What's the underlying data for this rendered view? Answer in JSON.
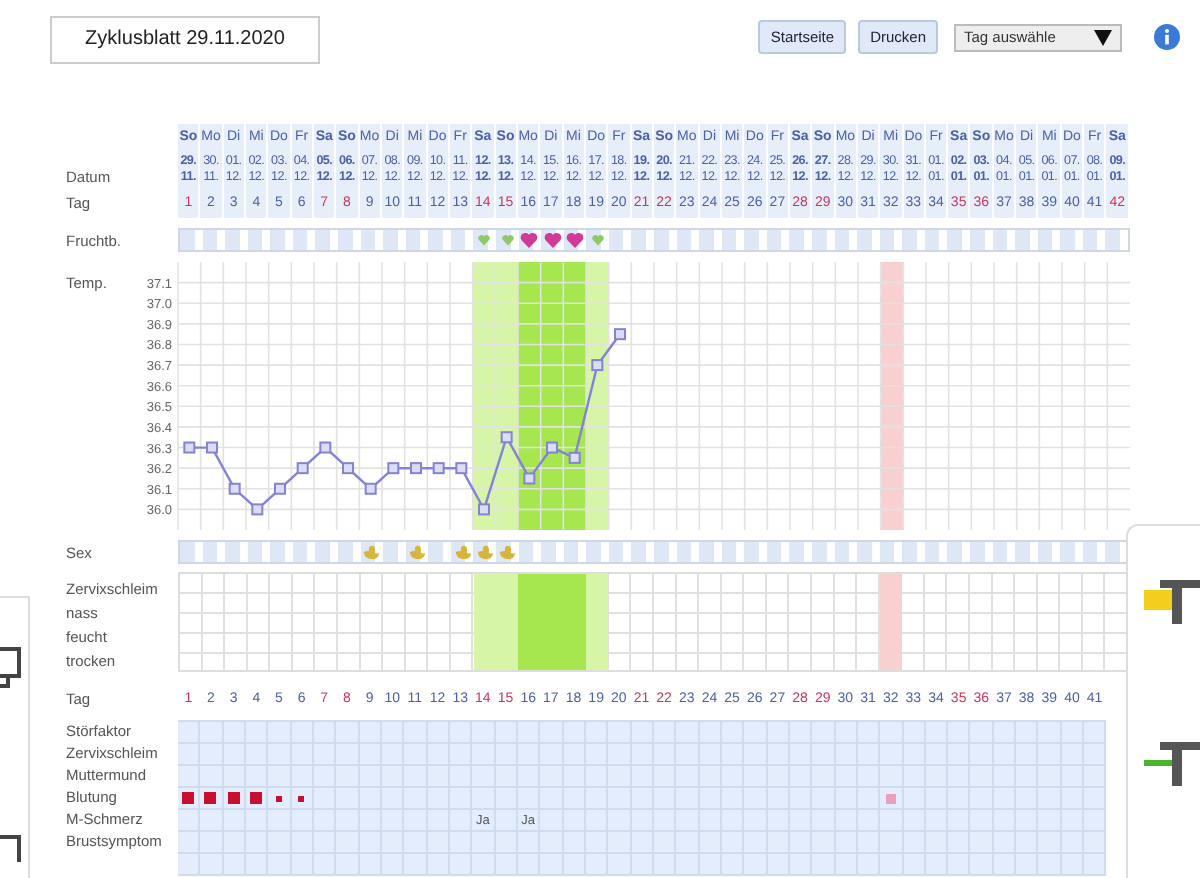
{
  "title": "Zyklusblatt 29.11.2020",
  "buttons": [
    {
      "label": "Startseite"
    },
    {
      "label": "Drucken"
    }
  ],
  "day_select": {
    "value": "Tag auswähle"
  },
  "labels": {
    "date": "Datum",
    "day": "Tag",
    "fertility": "Fruchtb.",
    "temp": "Temp.",
    "sex": "Sex",
    "mucus": "Zervixschleim",
    "mucus_levels": [
      "nass",
      "feucht",
      "trocken"
    ],
    "day_lower": "Tag"
  },
  "days": [
    {
      "weekday": "So",
      "date": "29.",
      "month": "11.",
      "day": "1",
      "weekend": true,
      "fertile": false,
      "peak": false,
      "sex": false,
      "marked": false
    },
    {
      "weekday": "Mo",
      "date": "30.",
      "month": "11.",
      "day": "2",
      "weekend": false,
      "fertile": false,
      "peak": false,
      "sex": false,
      "marked": false
    },
    {
      "weekday": "Di",
      "date": "01.",
      "month": "12.",
      "day": "3",
      "weekend": false,
      "fertile": false,
      "peak": false,
      "sex": false,
      "marked": false
    },
    {
      "weekday": "Mi",
      "date": "02.",
      "month": "12.",
      "day": "4",
      "weekend": false,
      "fertile": false,
      "peak": false,
      "sex": false,
      "marked": false
    },
    {
      "weekday": "Do",
      "date": "03.",
      "month": "12.",
      "day": "5",
      "weekend": false,
      "fertile": false,
      "peak": false,
      "sex": false,
      "marked": false
    },
    {
      "weekday": "Fr",
      "date": "04.",
      "month": "12.",
      "day": "6",
      "weekend": false,
      "fertile": false,
      "peak": false,
      "sex": false,
      "marked": false
    },
    {
      "weekday": "Sa",
      "date": "05.",
      "month": "12.",
      "day": "7",
      "weekend": true,
      "fertile": false,
      "peak": false,
      "sex": false,
      "marked": false
    },
    {
      "weekday": "So",
      "date": "06.",
      "month": "12.",
      "day": "8",
      "weekend": true,
      "fertile": false,
      "peak": false,
      "sex": false,
      "marked": false
    },
    {
      "weekday": "Mo",
      "date": "07.",
      "month": "12.",
      "day": "9",
      "weekend": false,
      "fertile": false,
      "peak": false,
      "sex": true,
      "marked": false
    },
    {
      "weekday": "Di",
      "date": "08.",
      "month": "12.",
      "day": "10",
      "weekend": false,
      "fertile": false,
      "peak": false,
      "sex": false,
      "marked": false
    },
    {
      "weekday": "Mi",
      "date": "09.",
      "month": "12.",
      "day": "11",
      "weekend": false,
      "fertile": false,
      "peak": false,
      "sex": true,
      "marked": false
    },
    {
      "weekday": "Do",
      "date": "10.",
      "month": "12.",
      "day": "12",
      "weekend": false,
      "fertile": false,
      "peak": false,
      "sex": false,
      "marked": false
    },
    {
      "weekday": "Fr",
      "date": "11.",
      "month": "12.",
      "day": "13",
      "weekend": false,
      "fertile": false,
      "peak": false,
      "sex": true,
      "marked": false
    },
    {
      "weekday": "Sa",
      "date": "12.",
      "month": "12.",
      "day": "14",
      "weekend": true,
      "fertile": true,
      "peak": false,
      "sex": true,
      "marked": false
    },
    {
      "weekday": "So",
      "date": "13.",
      "month": "12.",
      "day": "15",
      "weekend": true,
      "fertile": true,
      "peak": false,
      "sex": true,
      "marked": false
    },
    {
      "weekday": "Mo",
      "date": "14.",
      "month": "12.",
      "day": "16",
      "weekend": false,
      "fertile": true,
      "peak": true,
      "sex": false,
      "marked": false
    },
    {
      "weekday": "Di",
      "date": "15.",
      "month": "12.",
      "day": "17",
      "weekend": false,
      "fertile": true,
      "peak": true,
      "sex": false,
      "marked": false
    },
    {
      "weekday": "Mi",
      "date": "16.",
      "month": "12.",
      "day": "18",
      "weekend": false,
      "fertile": true,
      "peak": true,
      "sex": false,
      "marked": false
    },
    {
      "weekday": "Do",
      "date": "17.",
      "month": "12.",
      "day": "19",
      "weekend": false,
      "fertile": true,
      "peak": false,
      "sex": false,
      "marked": false
    },
    {
      "weekday": "Fr",
      "date": "18.",
      "month": "12.",
      "day": "20",
      "weekend": false,
      "fertile": false,
      "peak": false,
      "sex": false,
      "marked": false
    },
    {
      "weekday": "Sa",
      "date": "19.",
      "month": "12.",
      "day": "21",
      "weekend": true,
      "fertile": false,
      "peak": false,
      "sex": false,
      "marked": false
    },
    {
      "weekday": "So",
      "date": "20.",
      "month": "12.",
      "day": "22",
      "weekend": true,
      "fertile": false,
      "peak": false,
      "sex": false,
      "marked": false
    },
    {
      "weekday": "Mo",
      "date": "21.",
      "month": "12.",
      "day": "23",
      "weekend": false,
      "fertile": false,
      "peak": false,
      "sex": false,
      "marked": false
    },
    {
      "weekday": "Di",
      "date": "22.",
      "month": "12.",
      "day": "24",
      "weekend": false,
      "fertile": false,
      "peak": false,
      "sex": false,
      "marked": false
    },
    {
      "weekday": "Mi",
      "date": "23.",
      "month": "12.",
      "day": "25",
      "weekend": false,
      "fertile": false,
      "peak": false,
      "sex": false,
      "marked": false
    },
    {
      "weekday": "Do",
      "date": "24.",
      "month": "12.",
      "day": "26",
      "weekend": false,
      "fertile": false,
      "peak": false,
      "sex": false,
      "marked": false
    },
    {
      "weekday": "Fr",
      "date": "25.",
      "month": "12.",
      "day": "27",
      "weekend": false,
      "fertile": false,
      "peak": false,
      "sex": false,
      "marked": false
    },
    {
      "weekday": "Sa",
      "date": "26.",
      "month": "12.",
      "day": "28",
      "weekend": true,
      "fertile": false,
      "peak": false,
      "sex": false,
      "marked": false
    },
    {
      "weekday": "So",
      "date": "27.",
      "month": "12.",
      "day": "29",
      "weekend": true,
      "fertile": false,
      "peak": false,
      "sex": false,
      "marked": false
    },
    {
      "weekday": "Mo",
      "date": "28.",
      "month": "12.",
      "day": "30",
      "weekend": false,
      "fertile": false,
      "peak": false,
      "sex": false,
      "marked": false
    },
    {
      "weekday": "Di",
      "date": "29.",
      "month": "12.",
      "day": "31",
      "weekend": false,
      "fertile": false,
      "peak": false,
      "sex": false,
      "marked": false
    },
    {
      "weekday": "Mi",
      "date": "30.",
      "month": "12.",
      "day": "32",
      "weekend": false,
      "fertile": false,
      "peak": false,
      "sex": false,
      "marked": true
    },
    {
      "weekday": "Do",
      "date": "31.",
      "month": "12.",
      "day": "33",
      "weekend": false,
      "fertile": false,
      "peak": false,
      "sex": false,
      "marked": false
    },
    {
      "weekday": "Fr",
      "date": "01.",
      "month": "01.",
      "day": "34",
      "weekend": false,
      "fertile": false,
      "peak": false,
      "sex": false,
      "marked": false
    },
    {
      "weekday": "Sa",
      "date": "02.",
      "month": "01.",
      "day": "35",
      "weekend": true,
      "fertile": false,
      "peak": false,
      "sex": false,
      "marked": false
    },
    {
      "weekday": "So",
      "date": "03.",
      "month": "01.",
      "day": "36",
      "weekend": true,
      "fertile": false,
      "peak": false,
      "sex": false,
      "marked": false
    },
    {
      "weekday": "Mo",
      "date": "04.",
      "month": "01.",
      "day": "37",
      "weekend": false,
      "fertile": false,
      "peak": false,
      "sex": false,
      "marked": false
    },
    {
      "weekday": "Di",
      "date": "05.",
      "month": "01.",
      "day": "38",
      "weekend": false,
      "fertile": false,
      "peak": false,
      "sex": false,
      "marked": false
    },
    {
      "weekday": "Mi",
      "date": "06.",
      "month": "01.",
      "day": "39",
      "weekend": false,
      "fertile": false,
      "peak": false,
      "sex": false,
      "marked": false
    },
    {
      "weekday": "Do",
      "date": "07.",
      "month": "01.",
      "day": "40",
      "weekend": false,
      "fertile": false,
      "peak": false,
      "sex": false,
      "marked": false
    },
    {
      "weekday": "Fr",
      "date": "08.",
      "month": "01.",
      "day": "41",
      "weekend": false,
      "fertile": false,
      "peak": false,
      "sex": false,
      "marked": false
    },
    {
      "weekday": "Sa",
      "date": "09.",
      "month": "01.",
      "day": "42",
      "weekend": true,
      "fertile": false,
      "peak": false,
      "sex": false,
      "marked": false
    }
  ],
  "temperature": {
    "chart_data": {
      "type": "line",
      "categories": [
        null,
        null,
        null,
        null,
        null,
        null,
        null,
        null,
        null,
        null,
        null,
        null,
        null,
        null,
        null,
        null,
        null,
        null,
        null,
        null,
        null,
        null,
        null,
        null,
        null,
        null,
        null,
        null,
        null,
        null,
        null,
        null,
        null,
        null,
        null,
        null,
        null,
        null,
        null,
        null,
        null,
        null
      ],
      "ylim": [
        35.9,
        37.2
      ],
      "grid": true,
      "series": [
        {
          "color": "#8383d6",
          "marker": "square",
          "values": [
            36.3,
            36.3,
            36.1,
            36.0,
            36.1,
            36.2,
            36.3,
            36.2,
            36.1,
            36.2,
            36.2,
            36.2,
            36.2,
            36.0,
            36.35,
            36.15,
            36.3,
            36.25,
            36.7,
            36.85,
            null,
            null,
            null,
            null,
            null,
            null,
            null,
            null,
            null,
            null,
            null,
            null,
            null,
            null,
            null,
            null,
            null,
            null,
            null,
            null,
            null,
            null
          ]
        }
      ],
      "yticks": [
        {
          "value": 36.0,
          "label": "36.0"
        },
        {
          "value": 36.1,
          "label": "36.1"
        },
        {
          "value": 36.2,
          "label": "36.2"
        },
        {
          "value": 36.3,
          "label": "36.3"
        },
        {
          "value": 36.4,
          "label": "36.4"
        },
        {
          "value": 36.5,
          "label": "36.5"
        },
        {
          "value": 36.6,
          "label": "36.6"
        },
        {
          "value": 36.7,
          "label": "36.7"
        },
        {
          "value": 36.8,
          "label": "36.8"
        },
        {
          "value": 36.9,
          "label": "36.9"
        },
        {
          "value": 37.0,
          "label": "37.0"
        },
        {
          "value": 37.1,
          "label": "37.1"
        }
      ]
    }
  },
  "lower": {
    "rows": [
      {
        "label": "Störfaktor",
        "kind": "plain"
      },
      {
        "label": "Zervixschleim",
        "kind": "plain"
      },
      {
        "label": "Muttermund",
        "kind": "plain"
      },
      {
        "label": "Blutung",
        "kind": "bleeding"
      },
      {
        "label": "M-Schmerz",
        "kind": "pain"
      },
      {
        "label": "Brustsymptom",
        "kind": "plain"
      }
    ],
    "days": [
      {
        "day": "1",
        "weekend": true,
        "bleeding": {
          "heavy": true,
          "color": "#c8102e"
        }
      },
      {
        "day": "2",
        "weekend": false,
        "bleeding": {
          "heavy": true,
          "color": "#c8102e"
        }
      },
      {
        "day": "3",
        "weekend": false,
        "bleeding": {
          "heavy": true,
          "color": "#c8102e"
        }
      },
      {
        "day": "4",
        "weekend": false,
        "bleeding": {
          "heavy": true,
          "color": "#c8102e"
        }
      },
      {
        "day": "5",
        "weekend": false,
        "bleeding": {
          "heavy": false,
          "color": "#c8102e"
        }
      },
      {
        "day": "6",
        "weekend": false,
        "bleeding": {
          "heavy": false,
          "color": "#c8102e"
        }
      },
      {
        "day": "7",
        "weekend": true
      },
      {
        "day": "8",
        "weekend": true
      },
      {
        "day": "9",
        "weekend": false
      },
      {
        "day": "10",
        "weekend": false
      },
      {
        "day": "11",
        "weekend": false
      },
      {
        "day": "12",
        "weekend": false
      },
      {
        "day": "13",
        "weekend": false
      },
      {
        "day": "14",
        "weekend": true,
        "pain": "Ja"
      },
      {
        "day": "15",
        "weekend": true
      },
      {
        "day": "16",
        "weekend": false,
        "pain": "Ja"
      },
      {
        "day": "17",
        "weekend": false
      },
      {
        "day": "18",
        "weekend": false
      },
      {
        "day": "19",
        "weekend": false
      },
      {
        "day": "20",
        "weekend": false
      },
      {
        "day": "21",
        "weekend": true
      },
      {
        "day": "22",
        "weekend": true
      },
      {
        "day": "23",
        "weekend": false
      },
      {
        "day": "24",
        "weekend": false
      },
      {
        "day": "25",
        "weekend": false
      },
      {
        "day": "26",
        "weekend": false
      },
      {
        "day": "27",
        "weekend": false
      },
      {
        "day": "28",
        "weekend": true
      },
      {
        "day": "29",
        "weekend": true
      },
      {
        "day": "30",
        "weekend": false
      },
      {
        "day": "31",
        "weekend": false
      },
      {
        "day": "32",
        "weekend": false,
        "bleeding": {
          "heavy": false,
          "color": "#e8a0bc"
        }
      },
      {
        "day": "33",
        "weekend": false
      },
      {
        "day": "34",
        "weekend": false
      },
      {
        "day": "35",
        "weekend": true
      },
      {
        "day": "36",
        "weekend": true
      },
      {
        "day": "37",
        "weekend": false
      },
      {
        "day": "38",
        "weekend": false
      },
      {
        "day": "39",
        "weekend": false
      },
      {
        "day": "40",
        "weekend": false
      },
      {
        "day": "41",
        "weekend": false
      }
    ]
  }
}
